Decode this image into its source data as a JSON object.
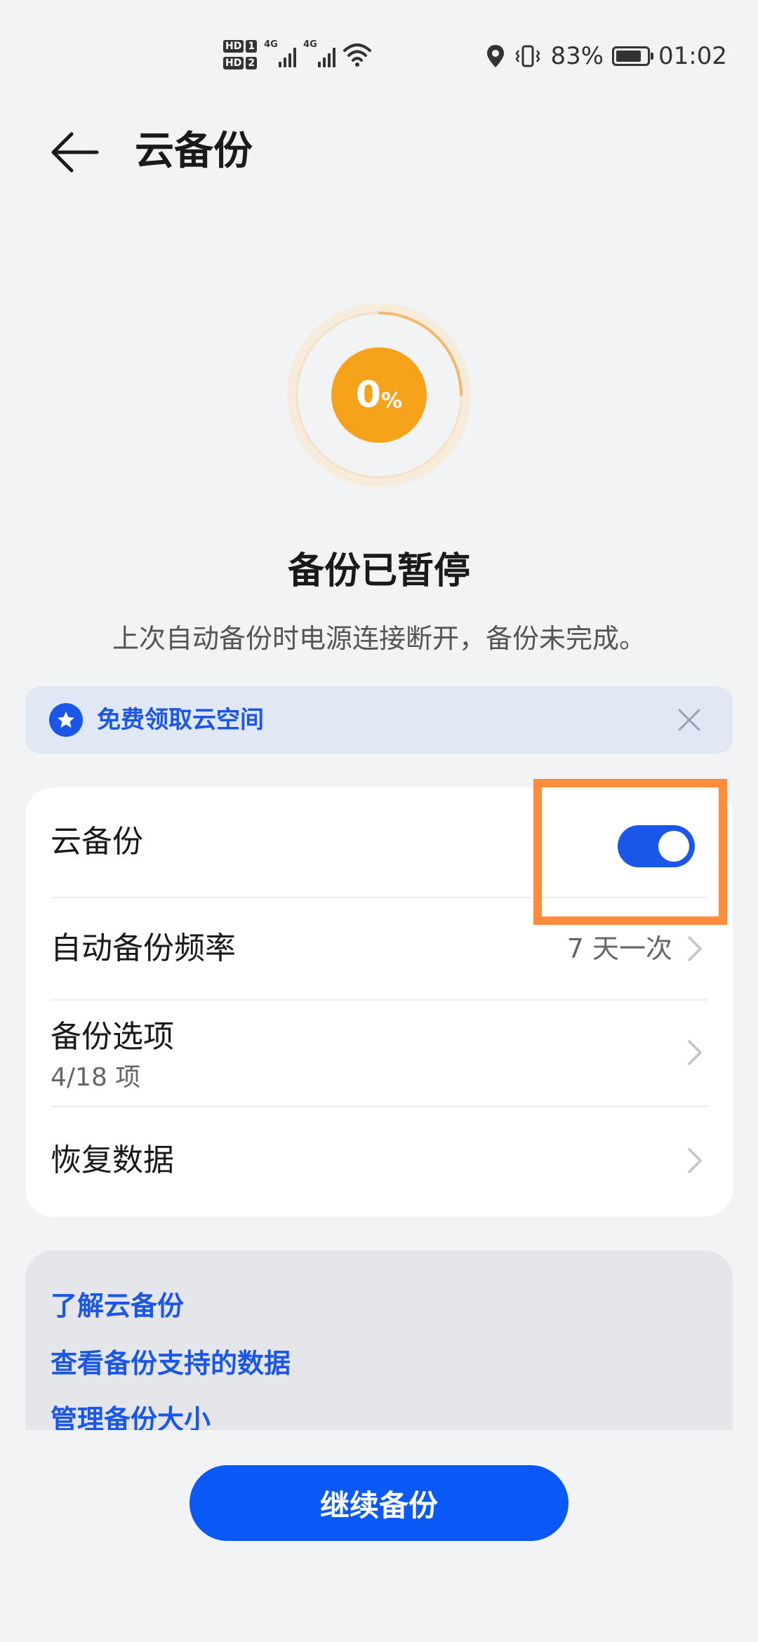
{
  "status_bar": {
    "sim1": "1",
    "sim2": "2",
    "hd": "HD",
    "network1": "4G",
    "network2": "4G",
    "battery_percent": "83%",
    "battery_level": 0.83,
    "time": "01:02"
  },
  "header": {
    "title": "云备份"
  },
  "progress": {
    "value": "0",
    "unit": "%",
    "fraction": 0
  },
  "status": {
    "title": "备份已暂停",
    "description": "上次自动备份时电源连接断开，备份未完成。"
  },
  "promo": {
    "label": "免费领取云空间"
  },
  "settings": {
    "cloud_backup_label": "云备份",
    "cloud_backup_enabled": true,
    "frequency_label": "自动备份频率",
    "frequency_value": "7 天一次",
    "options_label": "备份选项",
    "options_sub": "4/18 项",
    "restore_label": "恢复数据"
  },
  "links": {
    "learn": "了解云备份",
    "supported": "查看备份支持的数据",
    "manage": "管理备份大小"
  },
  "cta": {
    "label": "继续备份"
  },
  "colors": {
    "accent": "#1a56e8",
    "progress": "#f7a21b",
    "highlight": "#ff8c3a"
  }
}
